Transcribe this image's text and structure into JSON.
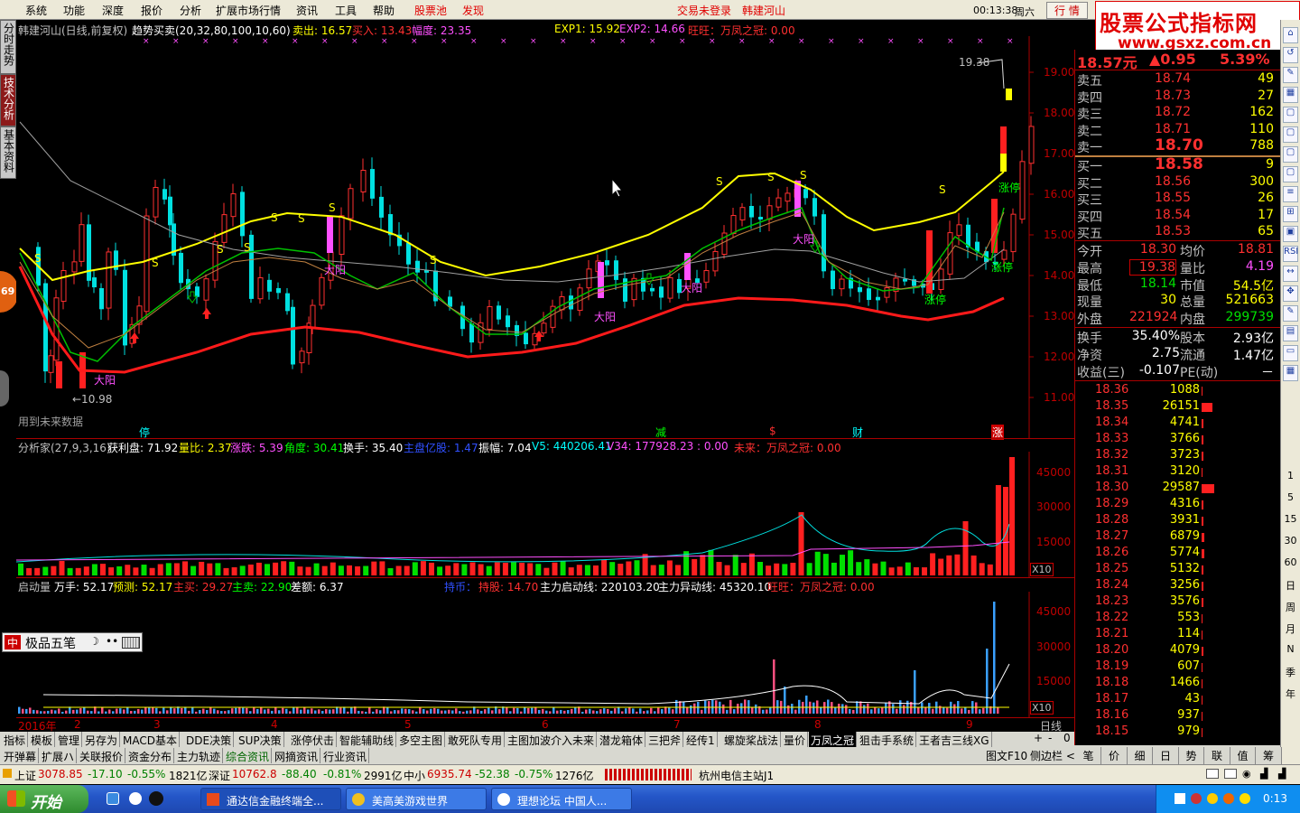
{
  "menu": {
    "items": [
      "系统",
      "功能",
      "深度",
      "报价",
      "分析",
      "扩展市场行情",
      "资讯",
      "工具",
      "帮助"
    ],
    "pool": "股票池",
    "discover": "发现",
    "login": "交易未登录",
    "stock_title": "韩建河山",
    "clock": "00:13:38",
    "weekday": "周六",
    "market_btn": "行 情"
  },
  "brand": {
    "cn": "股票公式指标网",
    "url": "www.gsxz.com.cn"
  },
  "left_tabs": [
    "分时走势",
    "技术分析",
    "基本资料"
  ],
  "left_badge": "69",
  "main": {
    "title": "韩建河山(日线,前复权)",
    "indicator": "趋势买卖(20,32,80,100,10,60)",
    "sell": "卖出: 16.57",
    "buy": "买入: 13.43",
    "amp": "幅度: 23.35",
    "exp1": "EXP1: 15.92",
    "exp2": "EXP2: 14.66",
    "wang": "旺旺：万凤之冠: 0.00",
    "price_axis": [
      "19.00",
      "18.00",
      "17.00",
      "16.00",
      "15.00",
      "14.00",
      "13.00",
      "12.00",
      "11.00"
    ],
    "high_mark": "19.38",
    "low_mark": "←10.98",
    "future_note": "用到未来数据",
    "bottom_marks": [
      "停",
      "减",
      "$",
      "财",
      "涨"
    ],
    "labels": [
      {
        "text": "大阳",
        "color": "#ff50ff"
      },
      {
        "text": "大阳",
        "color": "#ff50ff"
      },
      {
        "text": "大阳",
        "color": "#ff50ff"
      },
      {
        "text": "大阳",
        "color": "#ff50ff"
      },
      {
        "text": "大阳",
        "color": "#ff50ff"
      },
      {
        "text": "涨停",
        "color": "#00ff00"
      },
      {
        "text": "涨停",
        "color": "#00ff00"
      },
      {
        "text": "涨停",
        "color": "#00ff00"
      }
    ]
  },
  "sub1": {
    "title": "分析家(27,9,3,16)",
    "profit": "获利盘: 71.92",
    "ratio": "量比: 2.37",
    "change": "涨跌: 5.39",
    "angle": "角度: 30.41",
    "turnover": "换手: 35.40",
    "inst": "主盘亿股: 1.47",
    "amp": "振幅: 7.04",
    "v5": "V5: 440206.41",
    "v34": "V34: 177928.23 : 0.00",
    "future": "未来：万凤之冠: 0.00",
    "axis": [
      "45000",
      "30000",
      "15000"
    ],
    "unit": "X10"
  },
  "sub2": {
    "title": "启动量",
    "hand": "万手: 52.17",
    "predict": "预测: 52.17",
    "mainbuy": "主买: 29.27",
    "mainsell": "主卖: 22.90",
    "diff": "差额: 6.37",
    "hold": "持币：",
    "holdshares": "持股: 14.70",
    "mainline": "主力启动线: 220103.20",
    "abnormal": "主力异动线: 45320.10",
    "wang": "旺旺：万凤之冠: 0.00",
    "axis": [
      "45000",
      "30000",
      "15000"
    ],
    "unit": "X10"
  },
  "ime": {
    "label": "极品五笔"
  },
  "xaxis": {
    "labels": [
      "2016年",
      "2",
      "3",
      "4",
      "5",
      "6",
      "7",
      "8",
      "9"
    ],
    "period": "日线"
  },
  "tabs1": [
    "指标",
    "模板",
    "管理",
    "另存为",
    "MACD基本",
    "DDE决策",
    "SUP决策",
    "涨停伏击",
    "智能辅助线",
    "多空主图",
    "敢死队专用",
    "主图加波介入未来",
    "潜龙箱体",
    "三把斧",
    "经传1",
    "螺旋桨战法",
    "量价",
    "万凤之冠",
    "狙击手系统",
    "王者吉三线XG"
  ],
  "tabs2": [
    "开弹幕",
    "扩展ハ",
    "关联报价",
    "资金分布",
    "主力轨迹",
    "综合资讯",
    "网摘资讯",
    "行业资讯"
  ],
  "tabs2_right": [
    "图文F10",
    "侧边栏 <"
  ],
  "right": {
    "price": "18.57元",
    "change": "▲0.95",
    "pct": "5.39%",
    "asks": [
      {
        "l": "卖五",
        "p": "18.74",
        "v": "49"
      },
      {
        "l": "卖四",
        "p": "18.73",
        "v": "27"
      },
      {
        "l": "卖三",
        "p": "18.72",
        "v": "162"
      },
      {
        "l": "卖二",
        "p": "18.71",
        "v": "110"
      },
      {
        "l": "卖一",
        "p": "18.70",
        "v": "788"
      }
    ],
    "bids": [
      {
        "l": "买一",
        "p": "18.58",
        "v": "9"
      },
      {
        "l": "买二",
        "p": "18.56",
        "v": "300"
      },
      {
        "l": "买三",
        "p": "18.55",
        "v": "26"
      },
      {
        "l": "买四",
        "p": "18.54",
        "v": "17"
      },
      {
        "l": "买五",
        "p": "18.53",
        "v": "65"
      }
    ],
    "stats": [
      {
        "a": "今开",
        "av": "18.30",
        "b": "均价",
        "bv": "18.81"
      },
      {
        "a": "最高",
        "av": "19.38",
        "b": "量比",
        "bv": "4.19"
      },
      {
        "a": "最低",
        "av": "18.14",
        "b": "市值",
        "bv": "54.5亿"
      },
      {
        "a": "现量",
        "av": "30",
        "b": "总量",
        "bv": "521663"
      },
      {
        "a": "外盘",
        "av": "221924",
        "b": "内盘",
        "bv": "299739"
      }
    ],
    "stats2": [
      {
        "a": "换手",
        "av": "35.40%",
        "b": "股本",
        "bv": "2.93亿"
      },
      {
        "a": "净资",
        "av": "2.75",
        "b": "流通",
        "bv": "1.47亿"
      },
      {
        "a": "收益(三)",
        "av": "-0.107",
        "b": "PE(动)",
        "bv": "－"
      }
    ],
    "ticks": [
      {
        "p": "18.36",
        "v": "1088"
      },
      {
        "p": "18.35",
        "v": "26151"
      },
      {
        "p": "18.34",
        "v": "4741"
      },
      {
        "p": "18.33",
        "v": "3766"
      },
      {
        "p": "18.32",
        "v": "3723"
      },
      {
        "p": "18.31",
        "v": "3120"
      },
      {
        "p": "18.30",
        "v": "29587"
      },
      {
        "p": "18.29",
        "v": "4316"
      },
      {
        "p": "18.28",
        "v": "3931"
      },
      {
        "p": "18.27",
        "v": "6879"
      },
      {
        "p": "18.26",
        "v": "5774"
      },
      {
        "p": "18.25",
        "v": "5132"
      },
      {
        "p": "18.24",
        "v": "3256"
      },
      {
        "p": "18.23",
        "v": "3576"
      },
      {
        "p": "18.22",
        "v": "553"
      },
      {
        "p": "18.21",
        "v": "114"
      },
      {
        "p": "18.20",
        "v": "4079"
      },
      {
        "p": "18.19",
        "v": "607"
      },
      {
        "p": "18.18",
        "v": "1466"
      },
      {
        "p": "18.17",
        "v": "43"
      },
      {
        "p": "18.16",
        "v": "937"
      },
      {
        "p": "18.15",
        "v": "979"
      }
    ],
    "bottom_tabs": [
      "笔",
      "价",
      "细",
      "日",
      "势",
      "联",
      "值",
      "筹"
    ]
  },
  "right_tools": [
    "1",
    "5",
    "15",
    "30",
    "60",
    "日",
    "周",
    "月",
    "N",
    "季",
    "年"
  ],
  "status": {
    "sh": "上证",
    "sh_v": "3078.85",
    "sh_c": "-17.10",
    "sh_p": "-0.55%",
    "sh_a": "1821亿",
    "sz": "深证",
    "sz_v": "10762.8",
    "sz_c": "-88.40",
    "sz_p": "-0.81%",
    "sz_a": "2991亿",
    "zx": "中小",
    "zx_v": "6935.74",
    "zx_c": "-52.38",
    "zx_p": "-0.75%",
    "zx_a": "1276亿",
    "server": "杭州电信主站J1"
  },
  "taskbar": {
    "start": "开始",
    "tasks": [
      "通达信金融终端全...",
      "美高美游戏世界",
      "理想论坛 中国人..."
    ],
    "time": "0:13"
  }
}
